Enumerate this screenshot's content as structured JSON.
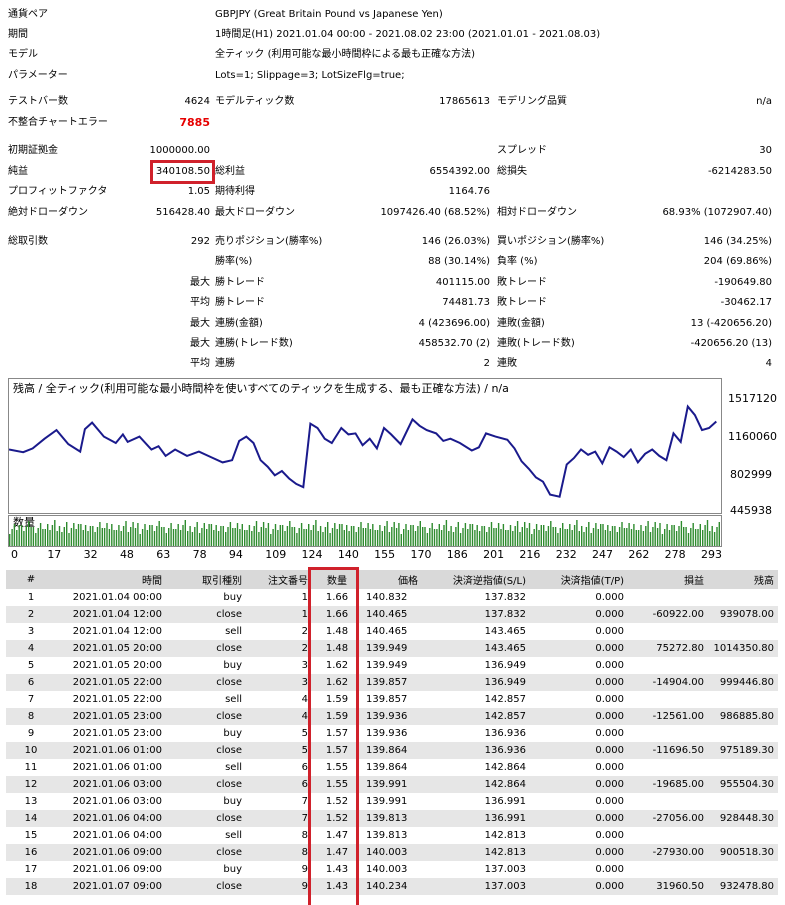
{
  "summary": {
    "pair_label": "通貨ペア",
    "pair_value": "GBPJPY (Great Britain Pound vs Japanese Yen)",
    "period_label": "期間",
    "period_value": "1時間足(H1) 2021.01.04 00:00 - 2021.08.02 23:00 (2021.01.01 - 2021.08.03)",
    "model_label": "モデル",
    "model_value": "全ティック (利用可能な最小時間枠による最も正確な方法)",
    "params_label": "パラメーター",
    "params_value": "Lots=1; Slippage=3; LotSizeFlg=true;",
    "bars_label": "テストバー数",
    "bars_value": "4624",
    "ticks_label": "モデルティック数",
    "ticks_value": "17865613",
    "quality_label": "モデリング品質",
    "quality_value": "n/a",
    "mismatch_label": "不整合チャートエラー",
    "mismatch_value": "7885",
    "deposit_label": "初期証拠金",
    "deposit_value": "1000000.00",
    "spread_label": "スプレッド",
    "spread_value": "30",
    "net_label": "純益",
    "net_value": "340108.50",
    "gross_profit_label": "総利益",
    "gross_profit_value": "6554392.00",
    "gross_loss_label": "総損失",
    "gross_loss_value": "-6214283.50",
    "pf_label": "プロフィットファクタ",
    "pf_value": "1.05",
    "expected_label": "期待利得",
    "expected_value": "1164.76",
    "abs_dd_label": "絶対ドローダウン",
    "abs_dd_value": "516428.40",
    "max_dd_label": "最大ドローダウン",
    "max_dd_value": "1097426.40 (68.52%)",
    "rel_dd_label": "相対ドローダウン",
    "rel_dd_value": "68.93% (1072907.40)",
    "trades_label": "総取引数",
    "trades_value": "292",
    "short_label": "売りポジション(勝率%)",
    "short_value": "146 (26.03%)",
    "long_label": "買いポジション(勝率%)",
    "long_value": "146 (34.25%)",
    "winrate_label": "勝率(%)",
    "winrate_value": "88 (30.14%)",
    "lossrate_label": "負率 (%)",
    "lossrate_value": "204 (69.86%)",
    "max_label": "最大",
    "avg_label": "平均",
    "max_win_label": "勝トレード",
    "max_win_value": "401115.00",
    "max_loss_label": "敗トレード",
    "max_loss_value": "-190649.80",
    "avg_win_label": "勝トレード",
    "avg_win_value": "74481.73",
    "avg_loss_label": "敗トレード",
    "avg_loss_value": "-30462.17",
    "max_consec_win_amt_label": "連勝(金額)",
    "max_consec_win_amt_value": "4 (423696.00)",
    "max_consec_loss_amt_label": "連敗(金額)",
    "max_consec_loss_amt_value": "13 (-420656.20)",
    "max_consec_win_cnt_label": "連勝(トレード数)",
    "max_consec_win_cnt_value": "458532.70 (2)",
    "max_consec_loss_cnt_label": "連敗(トレード数)",
    "max_consec_loss_cnt_value": "-420656.20 (13)",
    "avg_consec_win_label": "連勝",
    "avg_consec_win_value": "2",
    "avg_consec_loss_label": "連敗",
    "avg_consec_loss_value": "4"
  },
  "chart": {
    "title": "残高 / 全ティック(利用可能な最小時間枠を使いすべてのティックを生成する、最も正確な方法) / n/a",
    "volume_label": "数量",
    "y_ticks": [
      "1517120",
      "1160060",
      "802999",
      "445938"
    ],
    "x_ticks": [
      "0",
      "17",
      "32",
      "48",
      "63",
      "78",
      "94",
      "109",
      "124",
      "140",
      "155",
      "170",
      "186",
      "201",
      "216",
      "232",
      "247",
      "262",
      "278",
      "293"
    ],
    "line_color": "#1a1a8c",
    "volume_color": "#2e8b2e"
  },
  "chart_data": {
    "type": "line",
    "title": "残高 / 全ティック(利用可能な最小時間枠を使いすべてのティックを生成する、最も正確な方法) / n/a",
    "xlabel": "",
    "ylabel": "",
    "ylim": [
      445938,
      1600000
    ],
    "xlim": [
      0,
      300
    ],
    "x": [
      0,
      6,
      10,
      15,
      20,
      25,
      30,
      32,
      35,
      40,
      45,
      48,
      50,
      55,
      60,
      63,
      66,
      70,
      75,
      80,
      85,
      90,
      94,
      97,
      100,
      103,
      106,
      109,
      112,
      115,
      118,
      121,
      124,
      127,
      130,
      133,
      136,
      140,
      143,
      146,
      149,
      152,
      155,
      158,
      161,
      165,
      170,
      173,
      176,
      180,
      183,
      186,
      190,
      195,
      198,
      201,
      205,
      210,
      213,
      216,
      219,
      222,
      225,
      228,
      232,
      235,
      238,
      241,
      244,
      247,
      250,
      253,
      256,
      259,
      262,
      265,
      268,
      271,
      274,
      277,
      280,
      283,
      286,
      289,
      292,
      295,
      298
    ],
    "values": [
      1000000,
      975000,
      1010000,
      1100000,
      1180000,
      1050000,
      980000,
      1190000,
      1250000,
      1120000,
      1060000,
      1140000,
      1070000,
      1120000,
      1000000,
      1030000,
      940000,
      1000000,
      940000,
      980000,
      930000,
      880000,
      900000,
      1080000,
      1120000,
      1060000,
      900000,
      840000,
      760000,
      800000,
      730000,
      680000,
      650000,
      1240000,
      1200000,
      1100000,
      1060000,
      1200000,
      1140000,
      1150000,
      1040000,
      1100000,
      1010000,
      1200000,
      1140000,
      1050000,
      1280000,
      1220000,
      1180000,
      1150000,
      1080000,
      1100000,
      1060000,
      990000,
      1020000,
      1150000,
      1120000,
      1090000,
      1010000,
      890000,
      820000,
      740000,
      700000,
      580000,
      560000,
      860000,
      920000,
      1000000,
      950000,
      980000,
      870000,
      1020000,
      980000,
      930000,
      1000000,
      880000,
      960000,
      1000000,
      940000,
      900000,
      1150000,
      1070000,
      1400000,
      1320000,
      1180000,
      1200000,
      1260000
    ]
  },
  "table": {
    "headers": [
      "#",
      "時間",
      "取引種別",
      "注文番号",
      "数量",
      "価格",
      "決済逆指値(S/L)",
      "決済指値(T/P)",
      "損益",
      "残高"
    ],
    "rows": [
      [
        "1",
        "2021.01.04 00:00",
        "buy",
        "1",
        "1.66",
        "140.832",
        "137.832",
        "0.000",
        "",
        ""
      ],
      [
        "2",
        "2021.01.04 12:00",
        "close",
        "1",
        "1.66",
        "140.465",
        "137.832",
        "0.000",
        "-60922.00",
        "939078.00"
      ],
      [
        "3",
        "2021.01.04 12:00",
        "sell",
        "2",
        "1.48",
        "140.465",
        "143.465",
        "0.000",
        "",
        ""
      ],
      [
        "4",
        "2021.01.05 20:00",
        "close",
        "2",
        "1.48",
        "139.949",
        "143.465",
        "0.000",
        "75272.80",
        "1014350.80"
      ],
      [
        "5",
        "2021.01.05 20:00",
        "buy",
        "3",
        "1.62",
        "139.949",
        "136.949",
        "0.000",
        "",
        ""
      ],
      [
        "6",
        "2021.01.05 22:00",
        "close",
        "3",
        "1.62",
        "139.857",
        "136.949",
        "0.000",
        "-14904.00",
        "999446.80"
      ],
      [
        "7",
        "2021.01.05 22:00",
        "sell",
        "4",
        "1.59",
        "139.857",
        "142.857",
        "0.000",
        "",
        ""
      ],
      [
        "8",
        "2021.01.05 23:00",
        "close",
        "4",
        "1.59",
        "139.936",
        "142.857",
        "0.000",
        "-12561.00",
        "986885.80"
      ],
      [
        "9",
        "2021.01.05 23:00",
        "buy",
        "5",
        "1.57",
        "139.936",
        "136.936",
        "0.000",
        "",
        ""
      ],
      [
        "10",
        "2021.01.06 01:00",
        "close",
        "5",
        "1.57",
        "139.864",
        "136.936",
        "0.000",
        "-11696.50",
        "975189.30"
      ],
      [
        "11",
        "2021.01.06 01:00",
        "sell",
        "6",
        "1.55",
        "139.864",
        "142.864",
        "0.000",
        "",
        ""
      ],
      [
        "12",
        "2021.01.06 03:00",
        "close",
        "6",
        "1.55",
        "139.991",
        "142.864",
        "0.000",
        "-19685.00",
        "955504.30"
      ],
      [
        "13",
        "2021.01.06 03:00",
        "buy",
        "7",
        "1.52",
        "139.991",
        "136.991",
        "0.000",
        "",
        ""
      ],
      [
        "14",
        "2021.01.06 04:00",
        "close",
        "7",
        "1.52",
        "139.813",
        "136.991",
        "0.000",
        "-27056.00",
        "928448.30"
      ],
      [
        "15",
        "2021.01.06 04:00",
        "sell",
        "8",
        "1.47",
        "139.813",
        "142.813",
        "0.000",
        "",
        ""
      ],
      [
        "16",
        "2021.01.06 09:00",
        "close",
        "8",
        "1.47",
        "140.003",
        "142.813",
        "0.000",
        "-27930.00",
        "900518.30"
      ],
      [
        "17",
        "2021.01.06 09:00",
        "buy",
        "9",
        "1.43",
        "140.003",
        "137.003",
        "0.000",
        "",
        ""
      ],
      [
        "18",
        "2021.01.07 09:00",
        "close",
        "9",
        "1.43",
        "140.234",
        "137.003",
        "0.000",
        "31960.50",
        "932478.80"
      ]
    ]
  }
}
